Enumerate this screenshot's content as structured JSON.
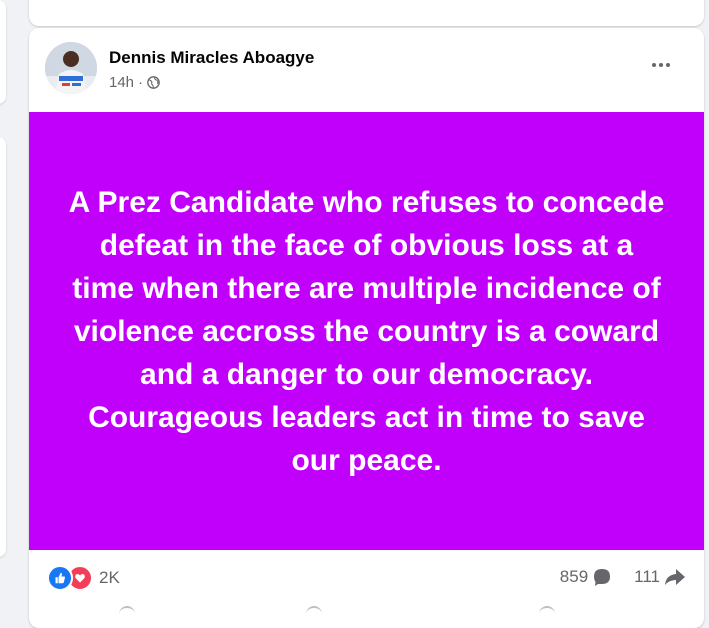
{
  "post": {
    "author": "Dennis Miracles Aboagye",
    "time": "14h",
    "privacy_icon": "globe-icon",
    "more_icon": "more-options-icon",
    "text": "A Prez Candidate who refuses to concede defeat in the face of obvious loss at a time when there are multiple incidence of violence accross the country is a coward and a danger to our democracy. Courageous leaders act in time to save our peace.",
    "background_color": "#c100fb",
    "text_color": "#ffffff"
  },
  "engagement": {
    "reaction_icons": [
      "like-icon",
      "love-icon"
    ],
    "reaction_count": "2K",
    "comment_count": "859",
    "share_count": "111"
  },
  "colors": {
    "like": "#1877f2",
    "love": "#f33e58",
    "page_background": "#f0f2f5"
  }
}
